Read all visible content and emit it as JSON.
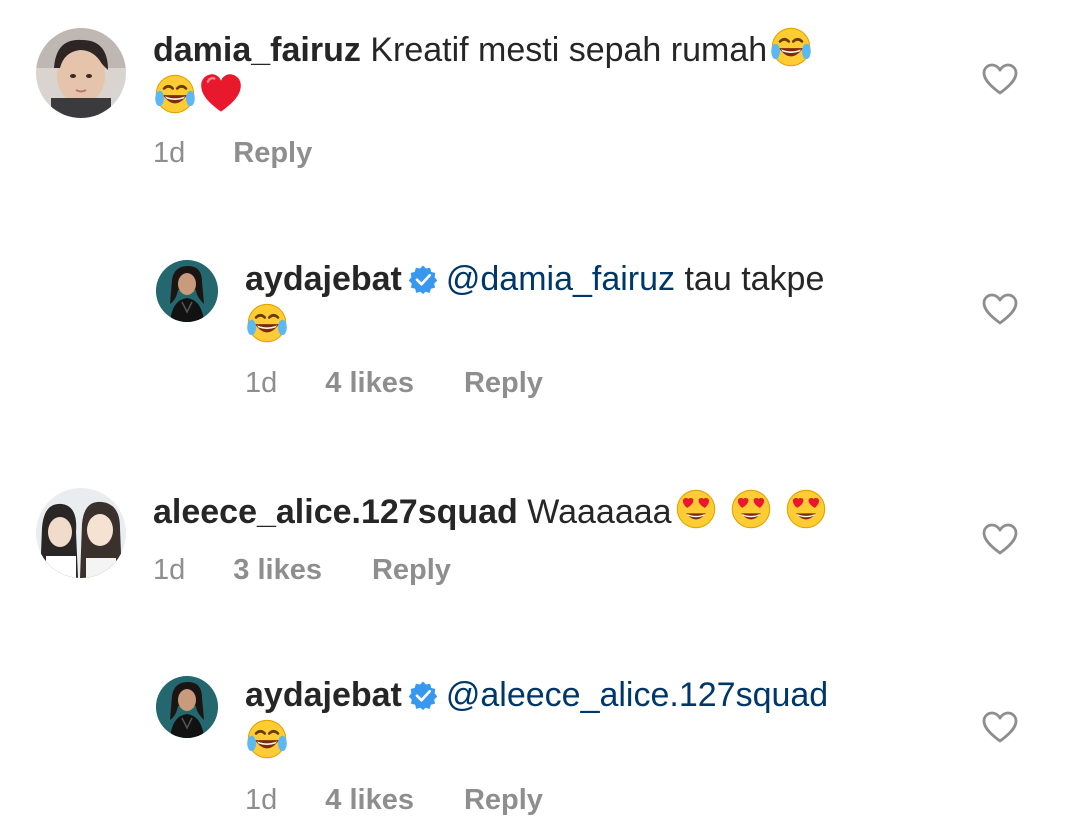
{
  "comments": [
    {
      "username": "damia_fairuz",
      "text": "Kreatif mesti sepah rumah",
      "emojis": [
        "face-with-tears-of-joy",
        "face-with-tears-of-joy",
        "red-heart"
      ],
      "time": "1d",
      "reply_label": "Reply"
    },
    {
      "username": "aydajebat",
      "verified": true,
      "mention": "@damia_fairuz",
      "text": "tau takpe",
      "emojis": [
        "face-with-tears-of-joy"
      ],
      "time": "1d",
      "likes": "4 likes",
      "reply_label": "Reply"
    },
    {
      "username": "aleece_alice.127squad",
      "text": "Waaaaaa",
      "emojis": [
        "smiling-face-with-heart-eyes",
        "smiling-face-with-heart-eyes",
        "smiling-face-with-heart-eyes"
      ],
      "time": "1d",
      "likes": "3 likes",
      "reply_label": "Reply"
    },
    {
      "username": "aydajebat",
      "verified": true,
      "mention": "@aleece_alice.127squad",
      "text": "",
      "emojis": [
        "face-with-tears-of-joy"
      ],
      "time": "1d",
      "likes": "4 likes",
      "reply_label": "Reply"
    }
  ],
  "colors": {
    "text": "#262626",
    "meta": "#8e8e8e",
    "mention": "#00376b",
    "verified": "#3897f0",
    "heart_outline": "#8e8e8e"
  }
}
